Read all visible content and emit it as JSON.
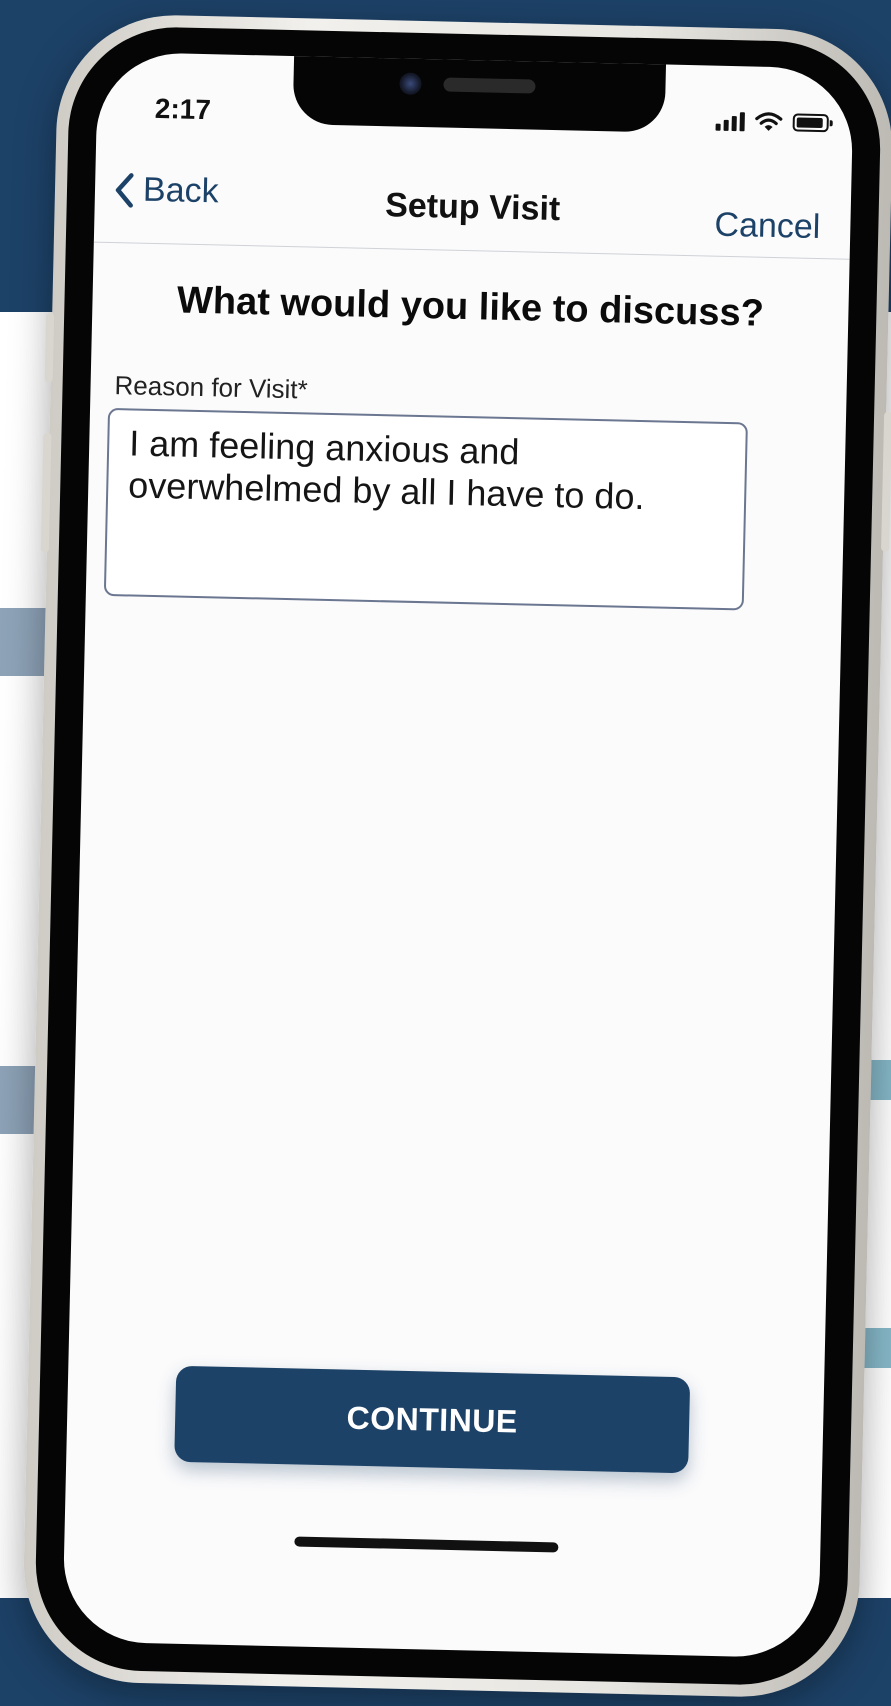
{
  "status_bar": {
    "time": "2:17",
    "icons": [
      "signal-icon",
      "wifi-icon",
      "battery-icon"
    ]
  },
  "navbar": {
    "back_label": "Back",
    "title": "Setup Visit",
    "cancel_label": "Cancel"
  },
  "form": {
    "heading": "What would you like to discuss?",
    "reason_label": "Reason for Visit*",
    "reason_value": "I am feeling anxious and overwhelmed by all I have to do."
  },
  "footer": {
    "continue_label": "CONTINUE"
  },
  "colors": {
    "brand": "#1d4268",
    "accent_stripe": "#86b8c8",
    "muted_stripe": "#8ea3b8"
  }
}
